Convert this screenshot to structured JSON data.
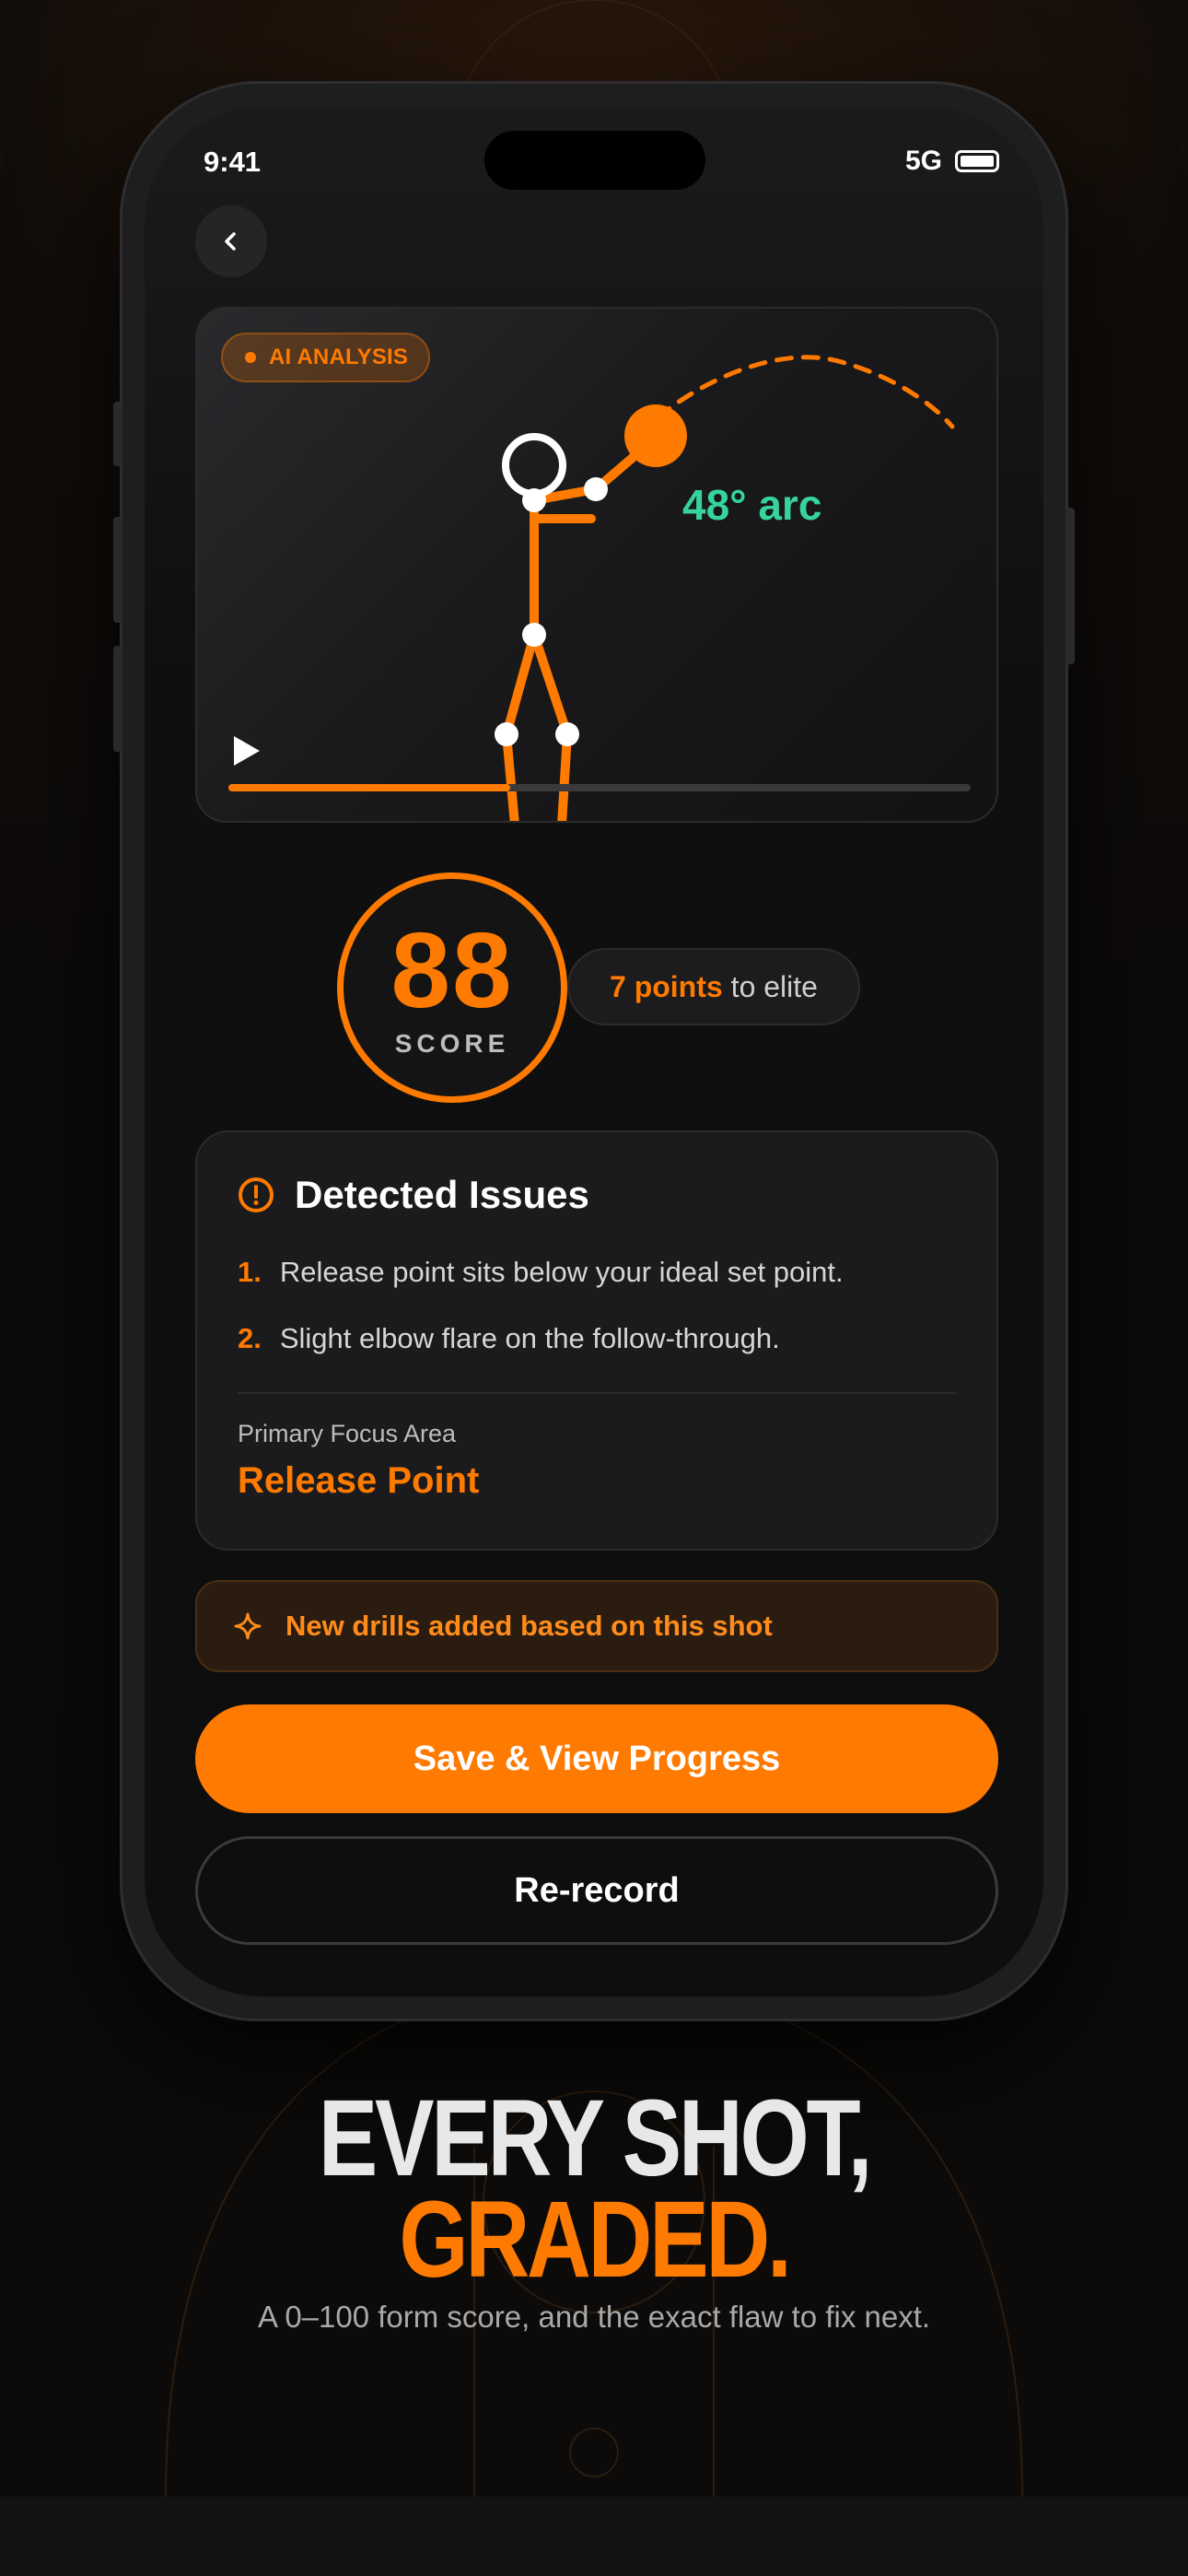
{
  "status_bar": {
    "time": "9:41",
    "network": "5G"
  },
  "video": {
    "badge": "AI ANALYSIS",
    "arc_label": "48° arc",
    "playback_progress": 0.38
  },
  "score": {
    "value": "88",
    "label": "SCORE",
    "to_elite_highlight": "7 points",
    "to_elite_rest": "to elite"
  },
  "issues": {
    "title": "Detected Issues",
    "items": [
      {
        "num": "1.",
        "text": "Release point sits below your ideal set point."
      },
      {
        "num": "2.",
        "text": "Slight elbow flare on the follow-through."
      }
    ],
    "focus_label": "Primary Focus Area",
    "focus_value": "Release Point"
  },
  "drills_banner": "New drills added based on this shot",
  "buttons": {
    "primary": "Save & View Progress",
    "secondary": "Re-record"
  },
  "marketing": {
    "headline_line1": "EVERY SHOT,",
    "headline_line2": "GRADED.",
    "subline": "A 0–100 form score, and the exact flaw to fix next."
  },
  "colors": {
    "accent": "#ff7a00",
    "arc_green": "#36d49a",
    "background": "#0d0b0a"
  },
  "icons": [
    "chevron-left-icon",
    "play-icon",
    "alert-circle-icon",
    "sparkle-icon",
    "battery-icon"
  ]
}
